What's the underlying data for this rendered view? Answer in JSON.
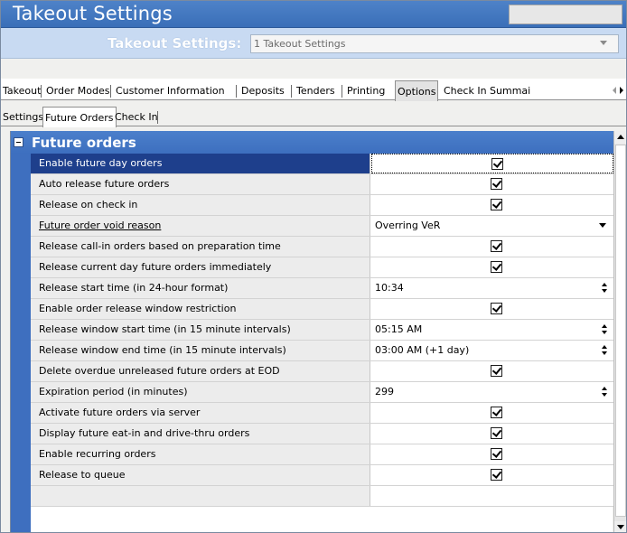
{
  "window": {
    "title": "Takeout Settings"
  },
  "header": {
    "label": "Takeout Settings:",
    "selected": "1 Takeout Settings"
  },
  "tabs_top": [
    {
      "label": "Takeout"
    },
    {
      "label": "Order Modes"
    },
    {
      "label": "Customer Information"
    },
    {
      "label": "Deposits"
    },
    {
      "label": "Tenders"
    },
    {
      "label": "Printing"
    },
    {
      "label": "Options",
      "active": true
    },
    {
      "label": "Check In Summai"
    }
  ],
  "tabs_sub": [
    {
      "label": "Settings"
    },
    {
      "label": "Future Orders",
      "active": true
    },
    {
      "label": "Check In"
    }
  ],
  "group": {
    "title": "Future orders"
  },
  "rows": [
    {
      "label": "Enable future day orders",
      "type": "checkbox",
      "checked": true
    },
    {
      "label": "Auto release future orders",
      "type": "checkbox",
      "checked": true
    },
    {
      "label": "Release on check in",
      "type": "checkbox",
      "checked": true
    },
    {
      "label": "Future order void reason",
      "type": "dropdown",
      "value": "Overring VeR"
    },
    {
      "label": "Release call-in orders based on preparation time",
      "type": "checkbox",
      "checked": true
    },
    {
      "label": "Release current day future orders immediately",
      "type": "checkbox",
      "checked": true
    },
    {
      "label": "Release start time (in 24-hour format)",
      "type": "spinner",
      "value": "10:34"
    },
    {
      "label": "Enable order release window restriction",
      "type": "checkbox",
      "checked": true
    },
    {
      "label": "Release window start time (in 15 minute intervals)",
      "type": "spinner",
      "value": "05:15 AM"
    },
    {
      "label": "Release window end time (in 15 minute intervals)",
      "type": "spinner",
      "value": "03:00 AM (+1 day)"
    },
    {
      "label": "Delete overdue unreleased future orders at EOD",
      "type": "checkbox",
      "checked": true
    },
    {
      "label": "Expiration period (in minutes)",
      "type": "spinner",
      "value": "299"
    },
    {
      "label": "Activate future orders via server",
      "type": "checkbox",
      "checked": true
    },
    {
      "label": "Display future eat-in and drive-thru orders",
      "type": "checkbox",
      "checked": true
    },
    {
      "label": "Enable recurring orders",
      "type": "checkbox",
      "checked": true
    },
    {
      "label": "Release to queue",
      "type": "checkbox",
      "checked": true
    }
  ]
}
